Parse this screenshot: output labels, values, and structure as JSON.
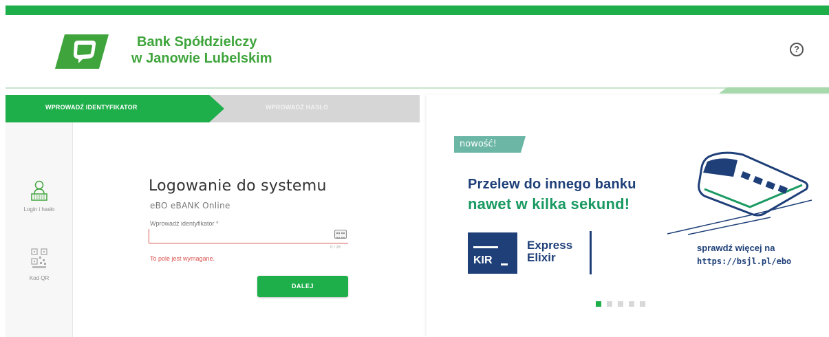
{
  "header": {
    "bank_name_line1": "Bank Spółdzielczy",
    "bank_name_line2": "w Janowie Lubelskim",
    "help_label": "?"
  },
  "steps": {
    "active_label": "WPROWADŹ IDENTYFIKATOR",
    "inactive_label": "WPROWADŹ HASŁO"
  },
  "sidebar": {
    "items": [
      {
        "label": "Login i hasło",
        "icon": "user-keyboard-icon",
        "active": true
      },
      {
        "label": "Kod QR",
        "icon": "qr-code-icon",
        "active": false
      }
    ]
  },
  "login": {
    "title": "Logowanie do systemu",
    "subtitle": "eBO eBANK Online",
    "field_label": "Wprowadź identyfikator *",
    "field_value": "",
    "counter": "0 / 16",
    "error": "To pole jest wymagane.",
    "next_button": "DALEJ"
  },
  "promo": {
    "badge": "nowość!",
    "line1": "Przelew do innego banku",
    "line2": "nawet w kilka sekund!",
    "kir_label": "KIR",
    "ee_line1": "Express",
    "ee_line2": "Elixir",
    "more_line1": "sprawdź więcej na",
    "more_line2": "https://bsjl.pl/ebo"
  },
  "carousel": {
    "count": 5,
    "active_index": 0
  },
  "colors": {
    "brand_green": "#1eae4a",
    "logo_green": "#3ea43b",
    "navy": "#1e3f78",
    "promo_green": "#1a9a62",
    "error_red": "#d9534f",
    "badge_teal": "#6cb6a6"
  }
}
